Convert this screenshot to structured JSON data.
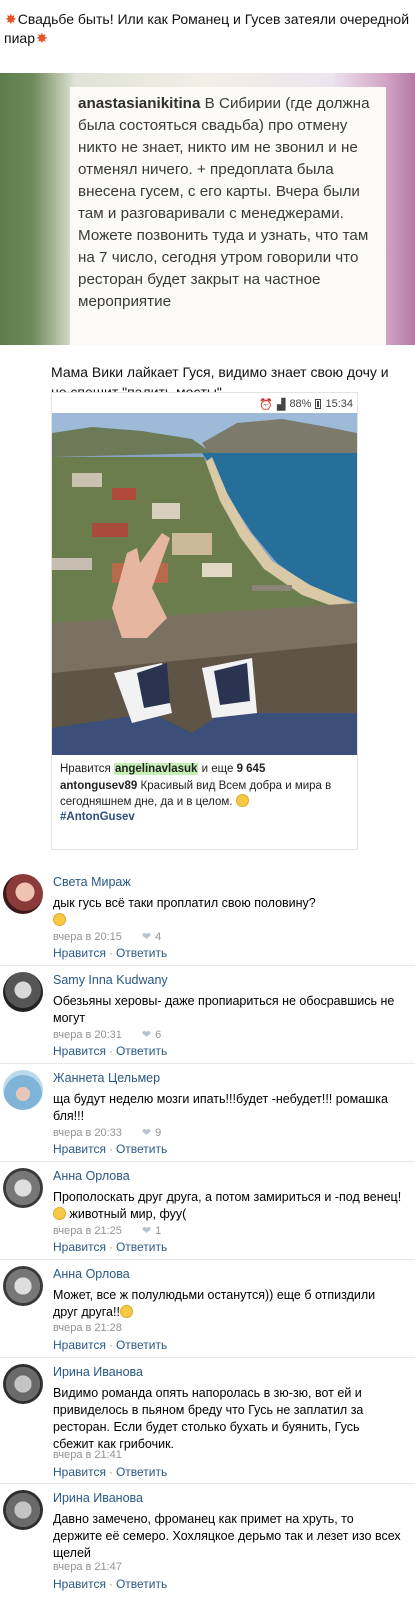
{
  "post": {
    "title": "Свадьбе быть! Или как Романец и Гусев затеяли очередной пиар",
    "quote_user": "anastasianikitina",
    "quote_text": " В Сибирии (где должна была состояться свадьба) про отмену никто не знает, никто им не звонил и не отменял ничего. + предоплата была внесена гусем, с его карты. Вчера были там и разговаривали с менеджерами. Можете позвонить туда и узнать, что там на 7 число, сегодня утром говорили что ресторан будет закрыт на частное мероприятие",
    "caption": "Мама Вики лайкает Гуся, видимо знает свою дочу и не спешит \"палить мосты\""
  },
  "phone": {
    "status_battery": "88%",
    "status_time": "15:34",
    "likes_prefix": "Нравится ",
    "likes_user": "angelinavlasuk",
    "likes_suffix": " и еще ",
    "likes_count": "9 645",
    "desc_user": "antongusev89",
    "desc_text": " Красивый вид  Всем добра и мира в сегодняшнем дне, да и в целом. ",
    "desc_tag": "#AntonGusev"
  },
  "labels": {
    "like": "Нравится",
    "reply": "Ответить",
    "sep": "·"
  },
  "comments": [
    {
      "author": "Света Мираж",
      "text": "дык гусь всё таки проплатил свою половину?",
      "time": "вчера в 20:15",
      "likes": "4"
    },
    {
      "author": "Samy Inna Kudwany",
      "text": "Обезьяны херовы- даже пропиариться не обосравшись не могут",
      "time": "вчера в 20:31",
      "likes": "6"
    },
    {
      "author": "Жаннета Цельмер",
      "text": "ща будут неделю мозги ипать!!!будет -небудет!!! ромашка бля!!!",
      "time": "вчера в 20:33",
      "likes": "9"
    },
    {
      "author": "Анна Орлова",
      "text": "Прополоскать друг друга, а потом замириться и -под венец!",
      "text2": " животный мир, фуу(",
      "time": "вчера в 21:25",
      "likes": "1"
    },
    {
      "author": "Анна Орлова",
      "text": "Может, все ж полулюдьми останутся)) еще б отпиздили друг друга!!",
      "time": "вчера в 21:28",
      "likes": ""
    },
    {
      "author": "Ирина Иванова",
      "text": "Видимо романда опять напоролась в зю-зю, вот ей и привиделось в пьяном бреду что Гусь не заплатил за ресторан. Если будет столько бухать и буянить, Гусь сбежит как грибочик.",
      "time": "вчера в 21:41",
      "likes": ""
    },
    {
      "author": "Ирина Иванова",
      "text": "Давно замечено, фроманец как примет на хруть, то держите её семеро. Хохляцкое дерьмо так и лезет изо всех щелей",
      "time": "вчера в 21:47",
      "likes": ""
    }
  ],
  "colors": {
    "link": "#2a5885",
    "meta": "#939393",
    "highlight": "#c7f0b6"
  }
}
